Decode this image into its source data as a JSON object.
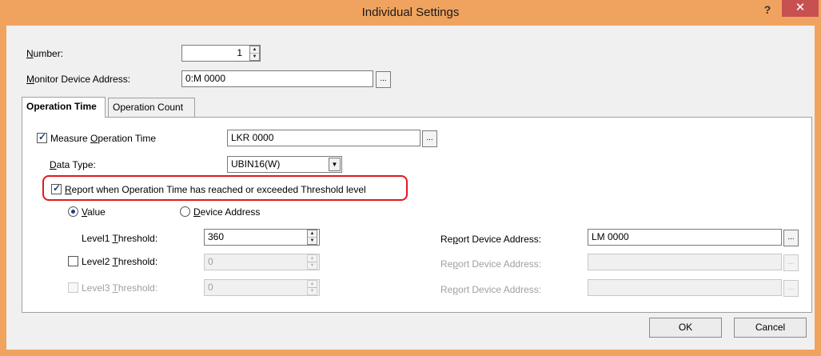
{
  "window": {
    "title": "Individual Settings",
    "help_glyph": "?",
    "close_glyph": "✕"
  },
  "number": {
    "label_prefix": "N",
    "label_rest": "umber:",
    "value": "1"
  },
  "monitor": {
    "label_prefix": "M",
    "label_rest": "onitor Device Address:",
    "value": "0:M 0000",
    "browse": "..."
  },
  "tabs": [
    {
      "label": "Operation Time",
      "active": true
    },
    {
      "label": "Operation Count",
      "active": false
    }
  ],
  "measure": {
    "label_pre": "Measure ",
    "label_u": "O",
    "label_post": "peration Time",
    "value": "LKR 0000",
    "browse": "...",
    "checked": true
  },
  "data_type": {
    "label_u": "D",
    "label_rest": "ata Type:",
    "value": "UBIN16(W)",
    "arrow": "▼"
  },
  "report": {
    "label_u": "R",
    "label_rest": "eport when Operation Time has reached or exceeded Threshold level",
    "checked": true
  },
  "radios": {
    "value": {
      "label_u": "V",
      "label_rest": "alue",
      "checked": true
    },
    "device": {
      "label_u": "D",
      "label_rest": "evice Address",
      "checked": false
    }
  },
  "levels": [
    {
      "label_pre": "Level1 ",
      "label_u": "T",
      "label_post": "hreshold:",
      "value": "360",
      "report_pre": "Re",
      "report_u": "p",
      "report_post": "ort Device Address:",
      "report_value": "LM 0000",
      "browse": "...",
      "enabled": true
    },
    {
      "label_pre": "Level2 ",
      "label_u": "T",
      "label_post": "hreshold:",
      "value": "0",
      "report_pre": "Re",
      "report_u": "p",
      "report_post": "ort Device Address:",
      "report_value": "",
      "browse": "...",
      "enabled": false
    },
    {
      "label_pre": "Level3 ",
      "label_u": "T",
      "label_post": "hreshold:",
      "value": "0",
      "report_pre": "Re",
      "report_u": "p",
      "report_post": "ort Device Address:",
      "report_value": "",
      "browse": "...",
      "enabled": false
    }
  ],
  "buttons": {
    "ok": "OK",
    "cancel": "Cancel"
  }
}
